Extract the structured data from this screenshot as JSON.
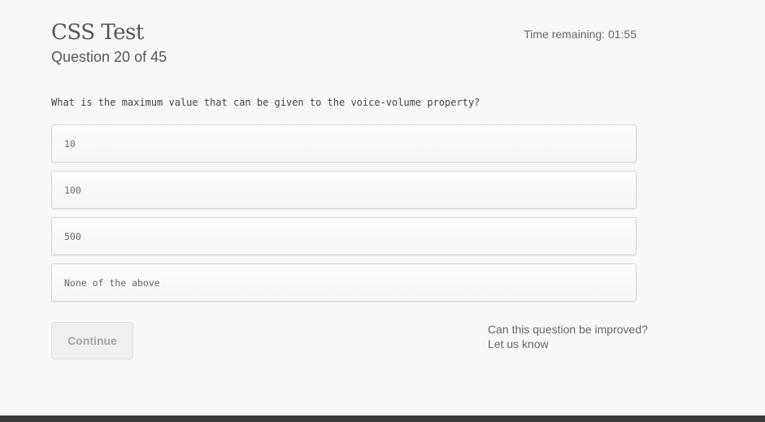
{
  "header": {
    "title": "CSS Test",
    "progress": "Question 20 of 45",
    "timer": "Time remaining: 01:55"
  },
  "question": {
    "text": "What is the maximum value that can be given to the voice-volume property?"
  },
  "options": [
    {
      "label": "10"
    },
    {
      "label": "100"
    },
    {
      "label": "500"
    },
    {
      "label": "None of the above"
    }
  ],
  "actions": {
    "continue_label": "Continue"
  },
  "feedback": {
    "line1": "Can this question be improved?",
    "line2": "Let us know"
  }
}
